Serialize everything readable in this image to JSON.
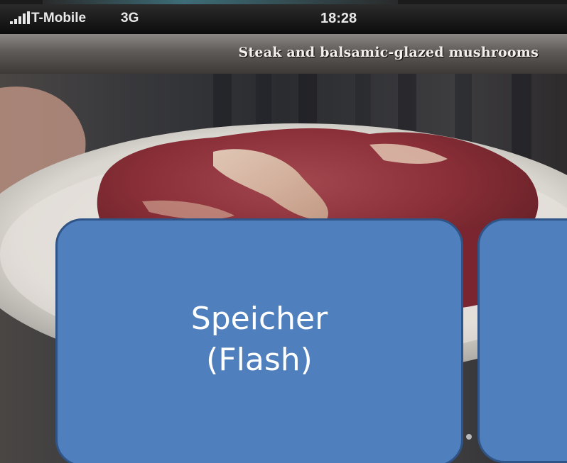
{
  "status_bar": {
    "carrier": "T-Mobile",
    "network": "3G",
    "time": "18:28",
    "signal_icon": "signal-bars-icon"
  },
  "title_bar": {
    "title": "Steak and balsamic-glazed mushrooms"
  },
  "photo": {
    "subject": "raw-steak-on-plate"
  },
  "overlay": {
    "box_main_line1": "Speicher",
    "box_main_line2": "(Flash)",
    "box_color": "#4f7fbd",
    "box_border_color": "#2f5487"
  },
  "colors": {
    "status_bar": "#111111",
    "title_bar": "#5e5a57",
    "title_text": "#f4f1ec"
  }
}
